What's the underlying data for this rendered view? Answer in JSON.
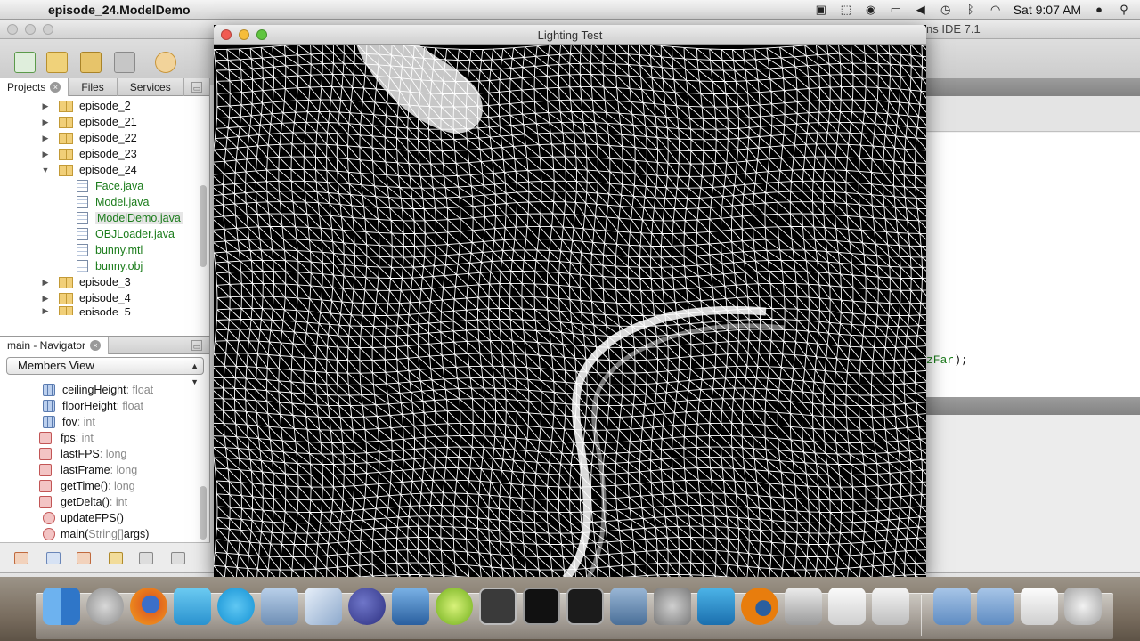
{
  "menubar": {
    "apple_glyph": "",
    "app_title": "episode_24.ModelDemo",
    "clock": "Sat 9:07 AM",
    "status_icons": [
      "camera-icon",
      "display-icon",
      "globe-icon",
      "monitor-icon",
      "volume-icon",
      "time-machine-icon",
      "bluetooth-icon",
      "wifi-icon",
      "user-icon",
      "spotlight-icon"
    ]
  },
  "ide": {
    "title_fragment": "ns IDE 7.1"
  },
  "projects": {
    "tabs": [
      {
        "label": "Projects"
      },
      {
        "label": "Files"
      },
      {
        "label": "Services"
      }
    ],
    "tree": [
      {
        "label": "episode_2",
        "kind": "package",
        "expanded": false
      },
      {
        "label": "episode_21",
        "kind": "package",
        "expanded": false
      },
      {
        "label": "episode_22",
        "kind": "package",
        "expanded": false
      },
      {
        "label": "episode_23",
        "kind": "package",
        "expanded": false
      },
      {
        "label": "episode_24",
        "kind": "package",
        "expanded": true
      },
      {
        "label": "Face.java",
        "kind": "file"
      },
      {
        "label": "Model.java",
        "kind": "file"
      },
      {
        "label": "ModelDemo.java",
        "kind": "file"
      },
      {
        "label": "OBJLoader.java",
        "kind": "file"
      },
      {
        "label": "bunny.mtl",
        "kind": "file"
      },
      {
        "label": "bunny.obj",
        "kind": "file"
      },
      {
        "label": "episode_3",
        "kind": "package",
        "expanded": false
      },
      {
        "label": "episode_4",
        "kind": "package",
        "expanded": false
      },
      {
        "label": "episode_5",
        "kind": "package",
        "expanded": false
      }
    ]
  },
  "navigator": {
    "title": "main - Navigator",
    "view_select": "Members View",
    "members": [
      {
        "name": "ceilingHeight",
        "type": " : float",
        "icon": "field"
      },
      {
        "name": "floorHeight",
        "type": " : float",
        "icon": "field"
      },
      {
        "name": "fov",
        "type": " : int",
        "icon": "field"
      },
      {
        "name": "fps",
        "type": " : int",
        "icon": "static"
      },
      {
        "name": "lastFPS",
        "type": " : long",
        "icon": "static"
      },
      {
        "name": "lastFrame",
        "type": " : long",
        "icon": "static"
      },
      {
        "name": "getTime()",
        "type": " : long",
        "icon": "static"
      },
      {
        "name": "getDelta()",
        "type": " : int",
        "icon": "static"
      },
      {
        "name": "updateFPS()",
        "type": "",
        "icon": "method"
      },
      {
        "name": "main(",
        "type": "String[]",
        "suffix": " args)",
        "icon": "method"
      }
    ]
  },
  "editor": {
    "code_fragment_hl": "zFar",
    "code_fragment_rest": ");"
  },
  "lighting_window": {
    "title": "Lighting Test"
  },
  "dock": {
    "icons": [
      "finder-icon",
      "launchpad-icon",
      "firefox-icon",
      "twitter-icon",
      "skype-icon",
      "preview-icon",
      "cube-icon",
      "eclipse-icon",
      "xcode-icon",
      "lime-icon",
      "blank-app-icon",
      "activity-monitor-icon",
      "terminal-icon",
      "video-icon",
      "system-preferences-icon",
      "blocks-icon",
      "blender-icon",
      "printer-icon",
      "textedit-icon",
      "java-icon",
      "applications-folder-icon",
      "documents-folder-icon",
      "downloads-stack-icon",
      "trash-icon"
    ],
    "colors": {
      "finder": "#4a8fd8",
      "firefox": "#e2671e",
      "twitter": "#3ca5d8",
      "skype": "#1aa3e0",
      "lime": "#8ed12a",
      "terminal": "#222222",
      "blender": "#e87d0d",
      "folder": "#7ea8d8"
    }
  }
}
